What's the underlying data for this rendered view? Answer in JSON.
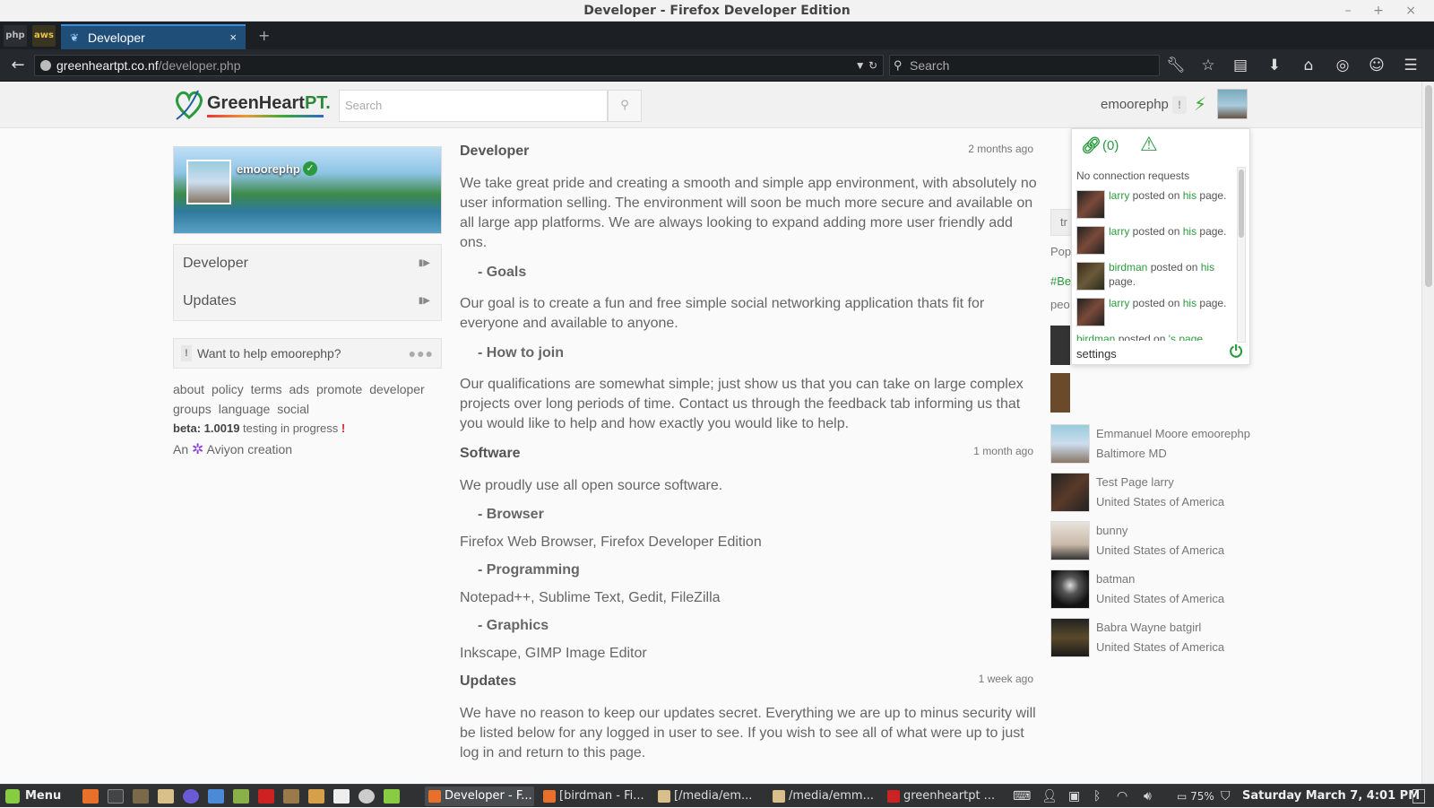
{
  "window": {
    "title": "Developer - Firefox Developer Edition",
    "controls": "– + ×"
  },
  "tabs": {
    "active_label": "Developer",
    "close": "×",
    "new": "+",
    "pinned": [
      "php",
      "aws"
    ]
  },
  "nav": {
    "url_domain": "greenheartpt.co.nf",
    "url_path": "/developer.php",
    "url_prefix": "",
    "search_placeholder": "Search",
    "back": "←"
  },
  "colors": {
    "brand_green": "#2b9a3e",
    "alert_red": "#d22222",
    "aviyon_purple": "#8a3ad6"
  },
  "site": {
    "logo_text_main": "GreenHeart",
    "logo_text_pt": "PT.",
    "search_placeholder": "Search",
    "username": "emoorephp",
    "alert": "!"
  },
  "profile": {
    "name": "emoorephp"
  },
  "sidebar": {
    "items": [
      {
        "label": "Developer"
      },
      {
        "label": "Updates"
      }
    ],
    "help_text": "Want to help emoorephp?",
    "help_bang": "!",
    "help_dots": "●●●",
    "footer_links": [
      "about",
      "policy",
      "terms",
      "ads",
      "promote",
      "developer",
      "groups",
      "language",
      "social"
    ],
    "beta_label": "beta: 1.0019",
    "beta_status": " testing in progress ",
    "beta_bang": "!",
    "credit_prefix": "An",
    "credit_name": "Aviyon creation"
  },
  "content": {
    "sections": [
      {
        "title": "Developer",
        "time": "2 months ago"
      },
      {
        "title": "Software",
        "time": "1 month ago"
      },
      {
        "title": "Updates",
        "time": "1 week ago"
      }
    ],
    "dev_intro": "We take great pride and creating a smooth and simple app environment, with absolutely no user information selling. The environment will soon be much more secure and available on all large app platforms. We are always looking to expand adding more user friendly add ons.",
    "goals_head": "- Goals",
    "goals_text": "Our goal is to create a fun and free simple social networking application thats fit for everyone and available to anyone.",
    "join_head": "- How to join",
    "join_text": "Our qualifications are somewhat simple; just show us that you can take on large complex projects over long periods of time. Contact us through the feedback tab informing us that you would like to help and how exactly you would like to help.",
    "software_intro": "We proudly use all open source software.",
    "browser_head": "- Browser",
    "browser_text": "Firefox Web Browser, Firefox Developer Edition",
    "prog_head": "- Programming",
    "prog_text": "Notepad++, Sublime Text, Gedit, FileZilla",
    "graphics_head": "- Graphics",
    "graphics_text": "Inkscape, GIMP Image Editor",
    "updates_text": "We have no reason to keep our updates secret. Everything we are up to minus security will be listed below for any logged in user to see. If you wish to see all of what were up to just log in and return to this page."
  },
  "rightcol": {
    "trend_box": "tr",
    "pop": "Pop",
    "tag": "#Be",
    "peo": "peo",
    "people": [
      {
        "name": "Emmanuel Moore emoorephp",
        "loc": "Baltimore MD"
      },
      {
        "name": "Test Page larry",
        "loc": "United States of America"
      },
      {
        "name": "bunny",
        "loc": "United States of America"
      },
      {
        "name": "batman",
        "loc": "United States of America"
      },
      {
        "name": "Babra Wayne batgirl",
        "loc": "United States of America"
      }
    ]
  },
  "notifications": {
    "count": "(0)",
    "no_requests": "No connection requests",
    "items": [
      {
        "user": "larry",
        "mid": " posted on ",
        "whose": "his",
        "end": " page."
      },
      {
        "user": "larry",
        "mid": " posted on ",
        "whose": "his",
        "end": " page."
      },
      {
        "user": "birdman",
        "mid": " posted on ",
        "whose": "his",
        "end": " page."
      },
      {
        "user": "larry",
        "mid": " posted on ",
        "whose": "his",
        "end": " page."
      },
      {
        "user": "birdman",
        "mid": " posted on ",
        "whose": "'s page",
        "end": ""
      }
    ],
    "settings": "settings"
  },
  "taskbar": {
    "menu": "Menu",
    "tasks": [
      {
        "label": "Developer - F...",
        "active": true
      },
      {
        "label": "[birdman - Fi...",
        "active": false
      },
      {
        "label": "[/media/em...",
        "active": false
      },
      {
        "label": "/media/emm...",
        "active": false
      },
      {
        "label": "greenheartpt ...",
        "active": false
      }
    ],
    "battery": "75%",
    "clock": "Saturday March  7,  4:01 PM"
  }
}
